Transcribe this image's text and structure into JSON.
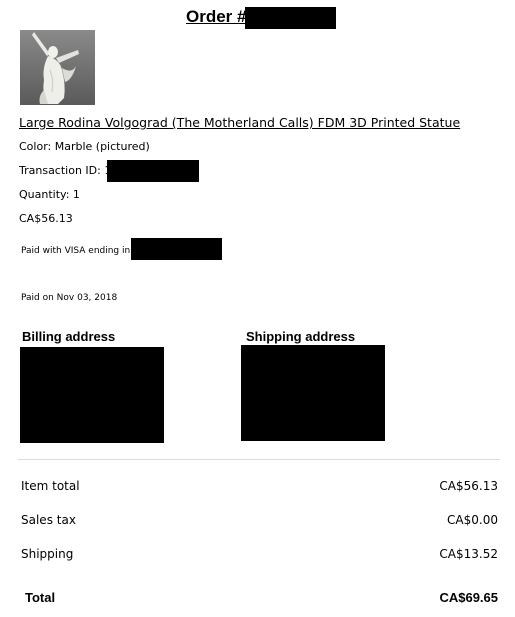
{
  "order": {
    "title_prefix": "Order #"
  },
  "product": {
    "name": "Large Rodina Volgograd (The Motherland Calls) FDM 3D Printed Statue",
    "color": "Color: Marble (pictured)",
    "transaction_label": "Transaction ID: 1",
    "quantity": "Quantity: 1",
    "price": "CA$56.13"
  },
  "payment": {
    "paid_with": "Paid with VISA ending in",
    "paid_on": "Paid on Nov 03, 2018"
  },
  "addresses": {
    "billing_heading": "Billing address",
    "shipping_heading": "Shipping address"
  },
  "summary": {
    "rows": [
      {
        "label": "Item total",
        "value": "CA$56.13"
      },
      {
        "label": "Sales tax",
        "value": "CA$0.00"
      },
      {
        "label": "Shipping",
        "value": "CA$13.52"
      }
    ],
    "total_label": "Total",
    "total_value": "CA$69.65"
  },
  "colors": {
    "redaction": "#000000",
    "divider": "#dcdcdc",
    "thumbnail_bg": "#6f6f6f"
  }
}
